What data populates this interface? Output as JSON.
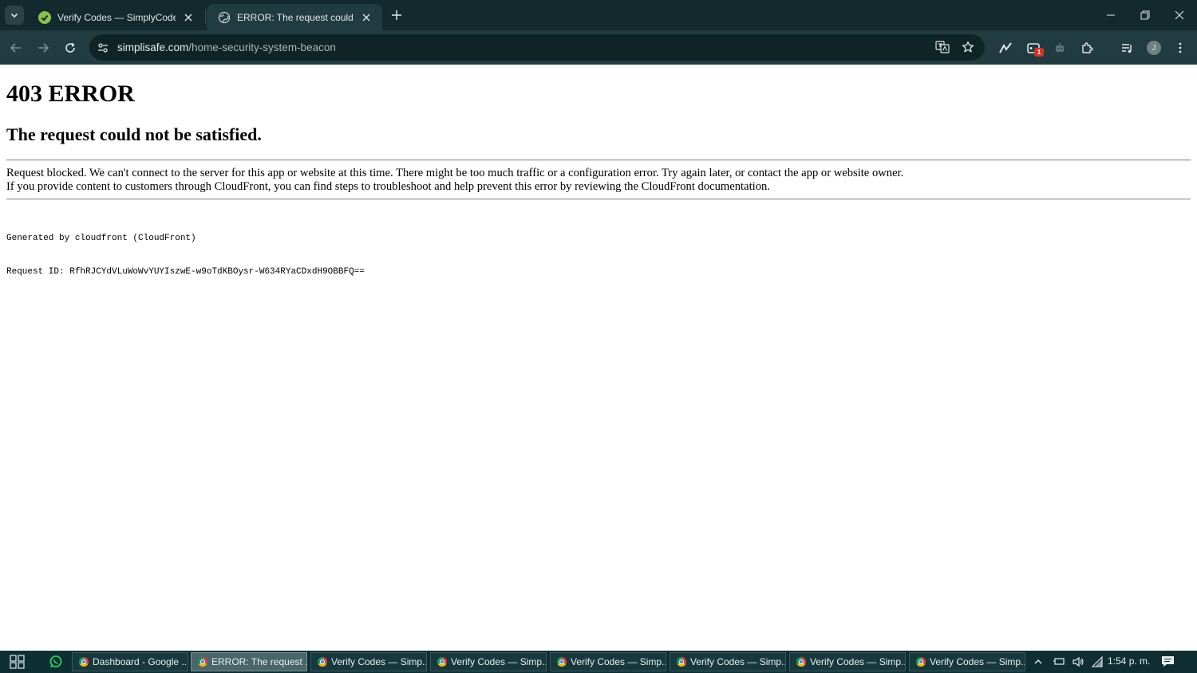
{
  "browser": {
    "tabs": [
      {
        "title": "Verify Codes — SimplyCodes",
        "favicon": "simplycodes-icon",
        "active": false
      },
      {
        "title": "ERROR: The request could not be satisfied",
        "favicon": "globe-icon",
        "active": true
      }
    ],
    "url_domain": "simplisafe.com",
    "url_path": "/home-security-system-beacon",
    "extension_badge": "1",
    "profile_initial": "J",
    "colors": {
      "frame": "#122a2e",
      "toolbar": "#213c40",
      "omnibox": "#0f2427"
    }
  },
  "page": {
    "title": "403 ERROR",
    "subtitle": "The request could not be satisfied.",
    "message_line1": "Request blocked. We can't connect to the server for this app or website at this time. There might be too much traffic or a configuration error. Try again later, or contact the app or website owner.",
    "message_line2": "If you provide content to customers through CloudFront, you can find steps to troubleshoot and help prevent this error by reviewing the CloudFront documentation.",
    "generated_by": "Generated by cloudfront (CloudFront)",
    "request_id": "Request ID: RfhRJCYdVLuWoWvYUYIszwE-w9oTdKBOysr-W634RYaCDxdH9OBBFQ=="
  },
  "taskbar": {
    "buttons": [
      {
        "label": "Dashboard - Google ...",
        "active": false
      },
      {
        "label": "ERROR: The request ...",
        "active": true
      },
      {
        "label": "Verify Codes — Simp...",
        "active": false
      },
      {
        "label": "Verify Codes — Simp...",
        "active": false
      },
      {
        "label": "Verify Codes — Simp...",
        "active": false
      },
      {
        "label": "Verify Codes — Simp...",
        "active": false
      },
      {
        "label": "Verify Codes — Simp...",
        "active": false
      },
      {
        "label": "Verify Codes — Simp...",
        "active": false
      }
    ],
    "clock": "1:54 p. m."
  }
}
